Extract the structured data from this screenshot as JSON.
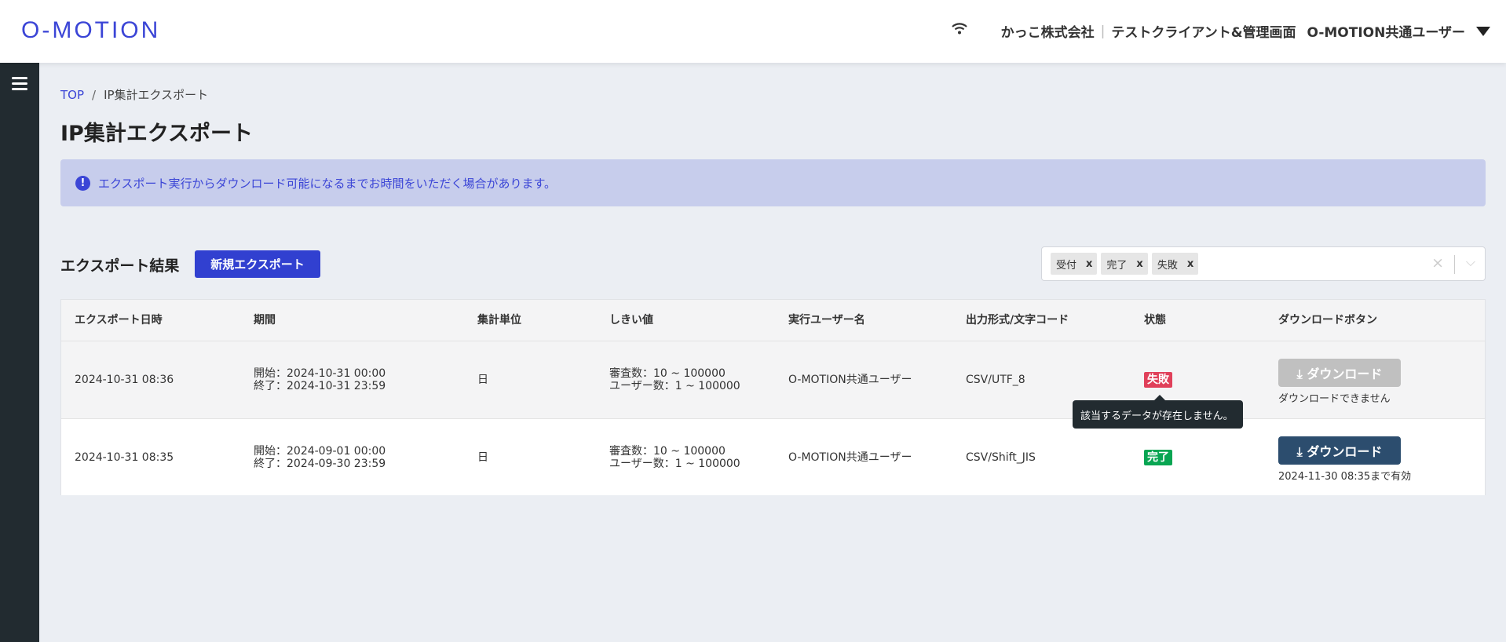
{
  "header": {
    "logo": "O-MOTION",
    "company": "かっこ株式会社",
    "separator": "|",
    "client": "テストクライアント&管理画面",
    "user": "O-MOTION共通ユーザー"
  },
  "breadcrumb": {
    "home": "TOP",
    "separator": "/",
    "current": "IP集計エクスポート"
  },
  "page_title": "IP集計エクスポート",
  "alert": {
    "icon": "!",
    "message": "エクスポート実行からダウンロード可能になるまでお時間をいただく場合があります。"
  },
  "section": {
    "title": "エクスポート結果",
    "new_export_label": "新規エクスポート"
  },
  "filter": {
    "chips": [
      "受付",
      "完了",
      "失敗"
    ],
    "chip_remove": "x",
    "clear": "×",
    "chevron": "⌵"
  },
  "table": {
    "headers": [
      "エクスポート日時",
      "期間",
      "集計単位",
      "しきい値",
      "実行ユーザー名",
      "出力形式/文字コード",
      "状態",
      "ダウンロードボタン"
    ],
    "rows": [
      {
        "datetime": "2024-10-31 08:36",
        "period_start": "開始：2024-10-31 00:00",
        "period_end": "終了：2024-10-31 23:59",
        "unit": "日",
        "threshold_1": "審査数：10 ~ 100000",
        "threshold_2": "ユーザー数：1 ~ 100000",
        "user": "O-MOTION共通ユーザー",
        "format": "CSV/UTF_8",
        "status": "失敗",
        "status_color": "#e0405a",
        "download_label": "ダウンロード",
        "download_note": "ダウンロードできません",
        "download_enabled": false
      },
      {
        "datetime": "2024-10-31 08:35",
        "period_start": "開始：2024-09-01 00:00",
        "period_end": "終了：2024-09-30 23:59",
        "unit": "日",
        "threshold_1": "審査数：10 ~ 100000",
        "threshold_2": "ユーザー数：1 ~ 100000",
        "user": "O-MOTION共通ユーザー",
        "format": "CSV/Shift_JIS",
        "status": "完了",
        "status_color": "#08a552",
        "download_label": "ダウンロード",
        "download_note": "2024-11-30 08:35まで有効",
        "download_enabled": true
      }
    ]
  },
  "tooltip": "該当するデータが存在しません。",
  "colors": {
    "brand": "#3b45d6",
    "sidebar": "#222b30",
    "download_active": "#2c4d6e",
    "download_disabled": "#c0c0c0"
  }
}
